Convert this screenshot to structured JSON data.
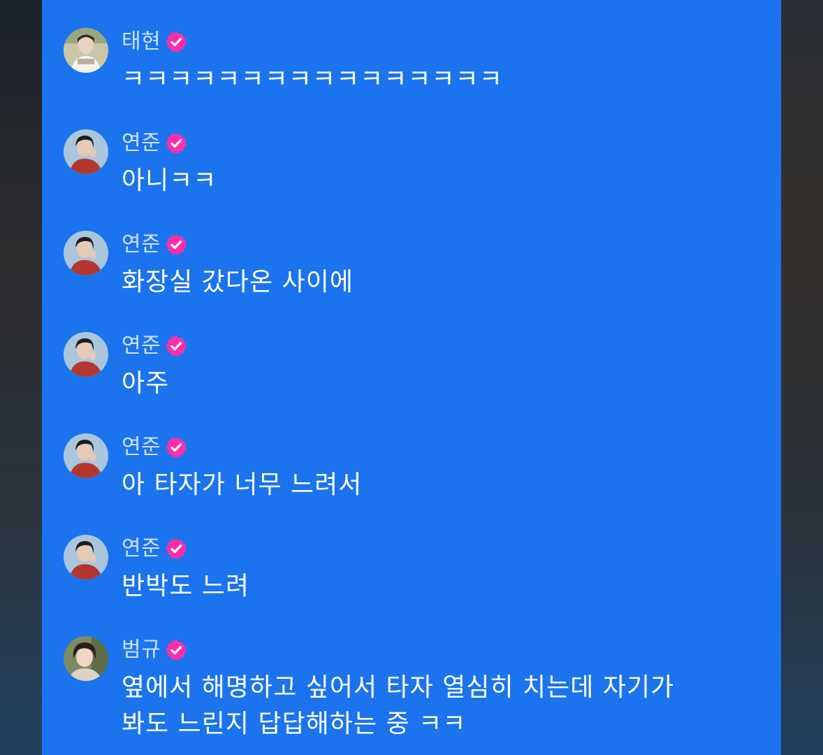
{
  "colors": {
    "panel_bg": "#1b74ee",
    "name_text": "#cfe2ff",
    "message_text": "#ffffff",
    "badge": "#ff2fa8"
  },
  "icons": {
    "close": "close-icon",
    "verified": "verified-badge-icon"
  },
  "messages": [
    {
      "name": "태현",
      "text": "ㅋㅋㅋㅋㅋㅋㅋㅋㅋㅋㅋㅋㅋㅋㅋㅋ",
      "avatar": "taehyun"
    },
    {
      "name": "연준",
      "text": "아니ㅋㅋ",
      "avatar": "yeonjun"
    },
    {
      "name": "연준",
      "text": "화장실 갔다온 사이에",
      "avatar": "yeonjun"
    },
    {
      "name": "연준",
      "text": "아주",
      "avatar": "yeonjun"
    },
    {
      "name": "연준",
      "text": "아 타자가 너무 느려서",
      "avatar": "yeonjun"
    },
    {
      "name": "연준",
      "text": "반박도 느려",
      "avatar": "yeonjun"
    },
    {
      "name": "범규",
      "text": "옆에서 해명하고 싶어서 타자 열심히 치는데 자기가\n봐도 느린지 답답해하는 중 ㅋㅋ",
      "avatar": "beomgyu"
    }
  ]
}
